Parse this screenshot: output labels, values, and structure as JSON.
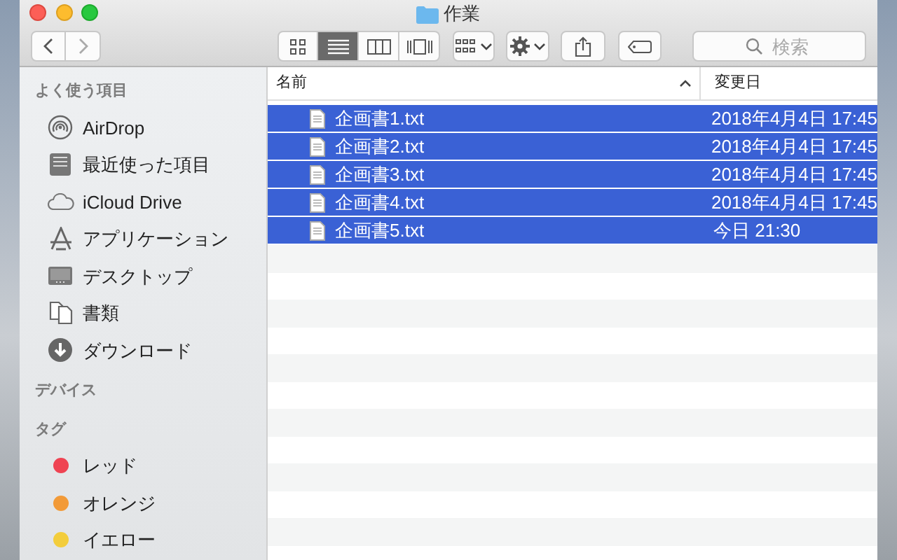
{
  "window": {
    "title": "作業"
  },
  "toolbar": {
    "view_modes": [
      {
        "kind": "icons",
        "selected": false
      },
      {
        "kind": "list",
        "selected": true
      },
      {
        "kind": "columns",
        "selected": false
      },
      {
        "kind": "gallery",
        "selected": false
      }
    ],
    "search": {
      "placeholder": "検索"
    }
  },
  "sidebar": {
    "sections": [
      {
        "heading": "よく使う項目",
        "items": [
          {
            "kind": "airdrop",
            "label": "AirDrop"
          },
          {
            "kind": "recent",
            "label": "最近使った項目"
          },
          {
            "kind": "cloud",
            "label": "iCloud Drive"
          },
          {
            "kind": "apps",
            "label": "アプリケーション"
          },
          {
            "kind": "desktop",
            "label": "デスクトップ"
          },
          {
            "kind": "documents",
            "label": "書類"
          },
          {
            "kind": "download",
            "label": "ダウンロード"
          }
        ]
      },
      {
        "heading": "デバイス"
      },
      {
        "heading": "タグ",
        "items": [
          {
            "kind": "tag",
            "label": "レッド",
            "color": "#ef4352"
          },
          {
            "kind": "tag",
            "label": "オレンジ",
            "color": "#f29a38"
          },
          {
            "kind": "tag",
            "label": "イエロー",
            "color": "#f3cd3c"
          }
        ]
      }
    ]
  },
  "files": {
    "columns": [
      "名前",
      "変更日"
    ],
    "rows": [
      {
        "name": "企画書1.txt",
        "modified": "2018年4月4日 17:45",
        "selected": true
      },
      {
        "name": "企画書2.txt",
        "modified": "2018年4月4日 17:45",
        "selected": true
      },
      {
        "name": "企画書3.txt",
        "modified": "2018年4月4日 17:45",
        "selected": true
      },
      {
        "name": "企画書4.txt",
        "modified": "2018年4月4日 17:45",
        "selected": true
      },
      {
        "name": "企画書5.txt",
        "modified": "今日 21:30",
        "selected": true
      }
    ]
  }
}
